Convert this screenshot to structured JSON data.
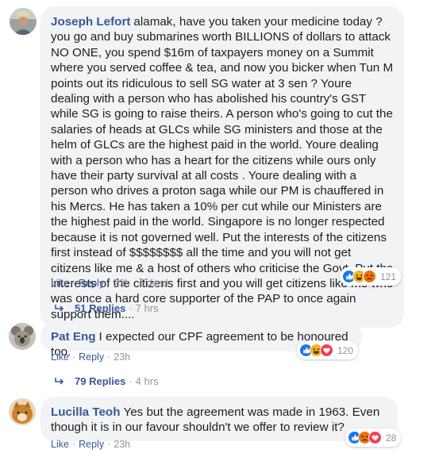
{
  "comments": [
    {
      "author": "Joseph Lefort",
      "text": "alamak, have you taken your medicine today ? you go and buy submarines worth BILLIONS of dollars to attack NO ONE, you spend $16m of taxpayers money on a Summit where you served coffee & tea, and now you bicker when Tun M points out its ridiculous to sell SG water at 3 sen ? Youre dealing with a person who has abolished his country's GST while SG is going to raise theirs. A person who's going to cut the salaries of heads at GLCs while SG ministers and those at the helm of GLCs are the highest paid in the world. Youre dealing with a person who has a heart for the citizens while ours only have their party survival at all costs . Youre dealing with a person who drives a proton saga while our PM is chauffered in his Mercs. He has taken a 10% per cut while our Ministers are the highest paid in the world. Singapore is no longer respected because it is not governed well. Put the interests of the citizens first instead of $$$$$$$$ all the time and you will not get citizens like me & a host of others who criticise the Govt. Put the interests of the citizens first and you will get citizens like me who was once a hard core supporter of the PAP to once again support them....",
      "reaction_count": "121",
      "like_label": "Like",
      "reply_label": "Reply",
      "time": "23h",
      "edited_label": "Edited",
      "replies_label": "51 Replies",
      "replies_time": "7 hrs"
    },
    {
      "author": "Pat Eng",
      "text": "I expected our CPF agreement to be honoured too.",
      "reaction_count": "120",
      "like_label": "Like",
      "reply_label": "Reply",
      "time": "23h",
      "replies_label": "79 Replies",
      "replies_time": "4 hrs"
    },
    {
      "author": "Lucilla Teoh",
      "text": "Yes but the agreement was made in 1963. Even though it is in our favour shouldn't we offer to review it?",
      "reaction_count": "28",
      "like_label": "Like",
      "reply_label": "Reply",
      "time": "23h"
    }
  ],
  "separator": "·",
  "colors": {
    "link": "#385898",
    "bubble": "#f2f3f5",
    "like": "#1877f2",
    "haha": "#f7b125",
    "angry": "#e9710f",
    "love": "#f33e58"
  },
  "icons": [
    "like-icon",
    "haha-icon",
    "angry-icon",
    "love-icon",
    "reply-arrow-icon"
  ]
}
